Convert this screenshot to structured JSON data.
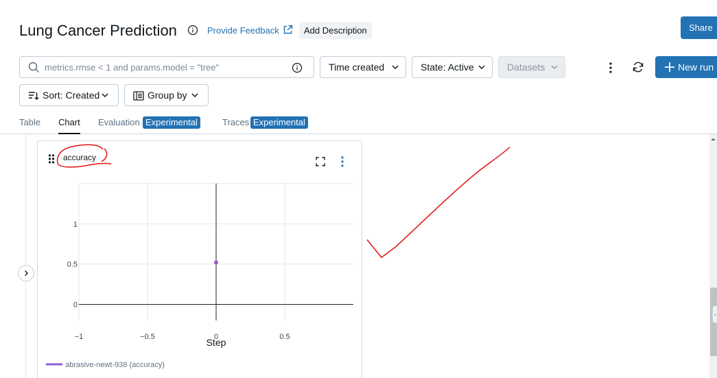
{
  "header": {
    "title": "Lung Cancer Prediction",
    "feedback_label": "Provide Feedback",
    "add_description_label": "Add Description",
    "share_label": "Share"
  },
  "toolbar": {
    "search_placeholder": "metrics.rmse < 1 and params.model = \"tree\"",
    "time_created_label": "Time created",
    "state_label": "State: Active",
    "datasets_label": "Datasets",
    "new_run_label": "New run",
    "sort_label": "Sort: Created",
    "group_by_label": "Group by"
  },
  "tabs": [
    {
      "label": "Table"
    },
    {
      "label": "Chart",
      "active": true
    },
    {
      "label": "Evaluation",
      "badge": "Experimental"
    },
    {
      "label": "Traces",
      "badge": "Experimental"
    }
  ],
  "chart_card": {
    "title": "accuracy"
  },
  "chart_data": {
    "type": "scatter",
    "title": "accuracy",
    "xlabel": "Step",
    "ylabel": "",
    "xlim": [
      -1,
      1
    ],
    "ylim": [
      -0.2,
      1.5
    ],
    "x_ticks": [
      "−1",
      "−0.5",
      "0",
      "0.5"
    ],
    "x_tick_values": [
      -1,
      -0.5,
      0,
      0.5
    ],
    "y_ticks": [
      "0",
      "0.5",
      "1"
    ],
    "y_tick_values": [
      0,
      0.5,
      1
    ],
    "grid": true,
    "legend_position": "bottom-left",
    "series": [
      {
        "name": "abrasive-newt-938 (accuracy)",
        "color": "#8c5ed0",
        "x": [
          0
        ],
        "y": [
          0.52
        ]
      }
    ]
  },
  "colors": {
    "accent": "#2272b4",
    "annotation": "#e01010"
  }
}
